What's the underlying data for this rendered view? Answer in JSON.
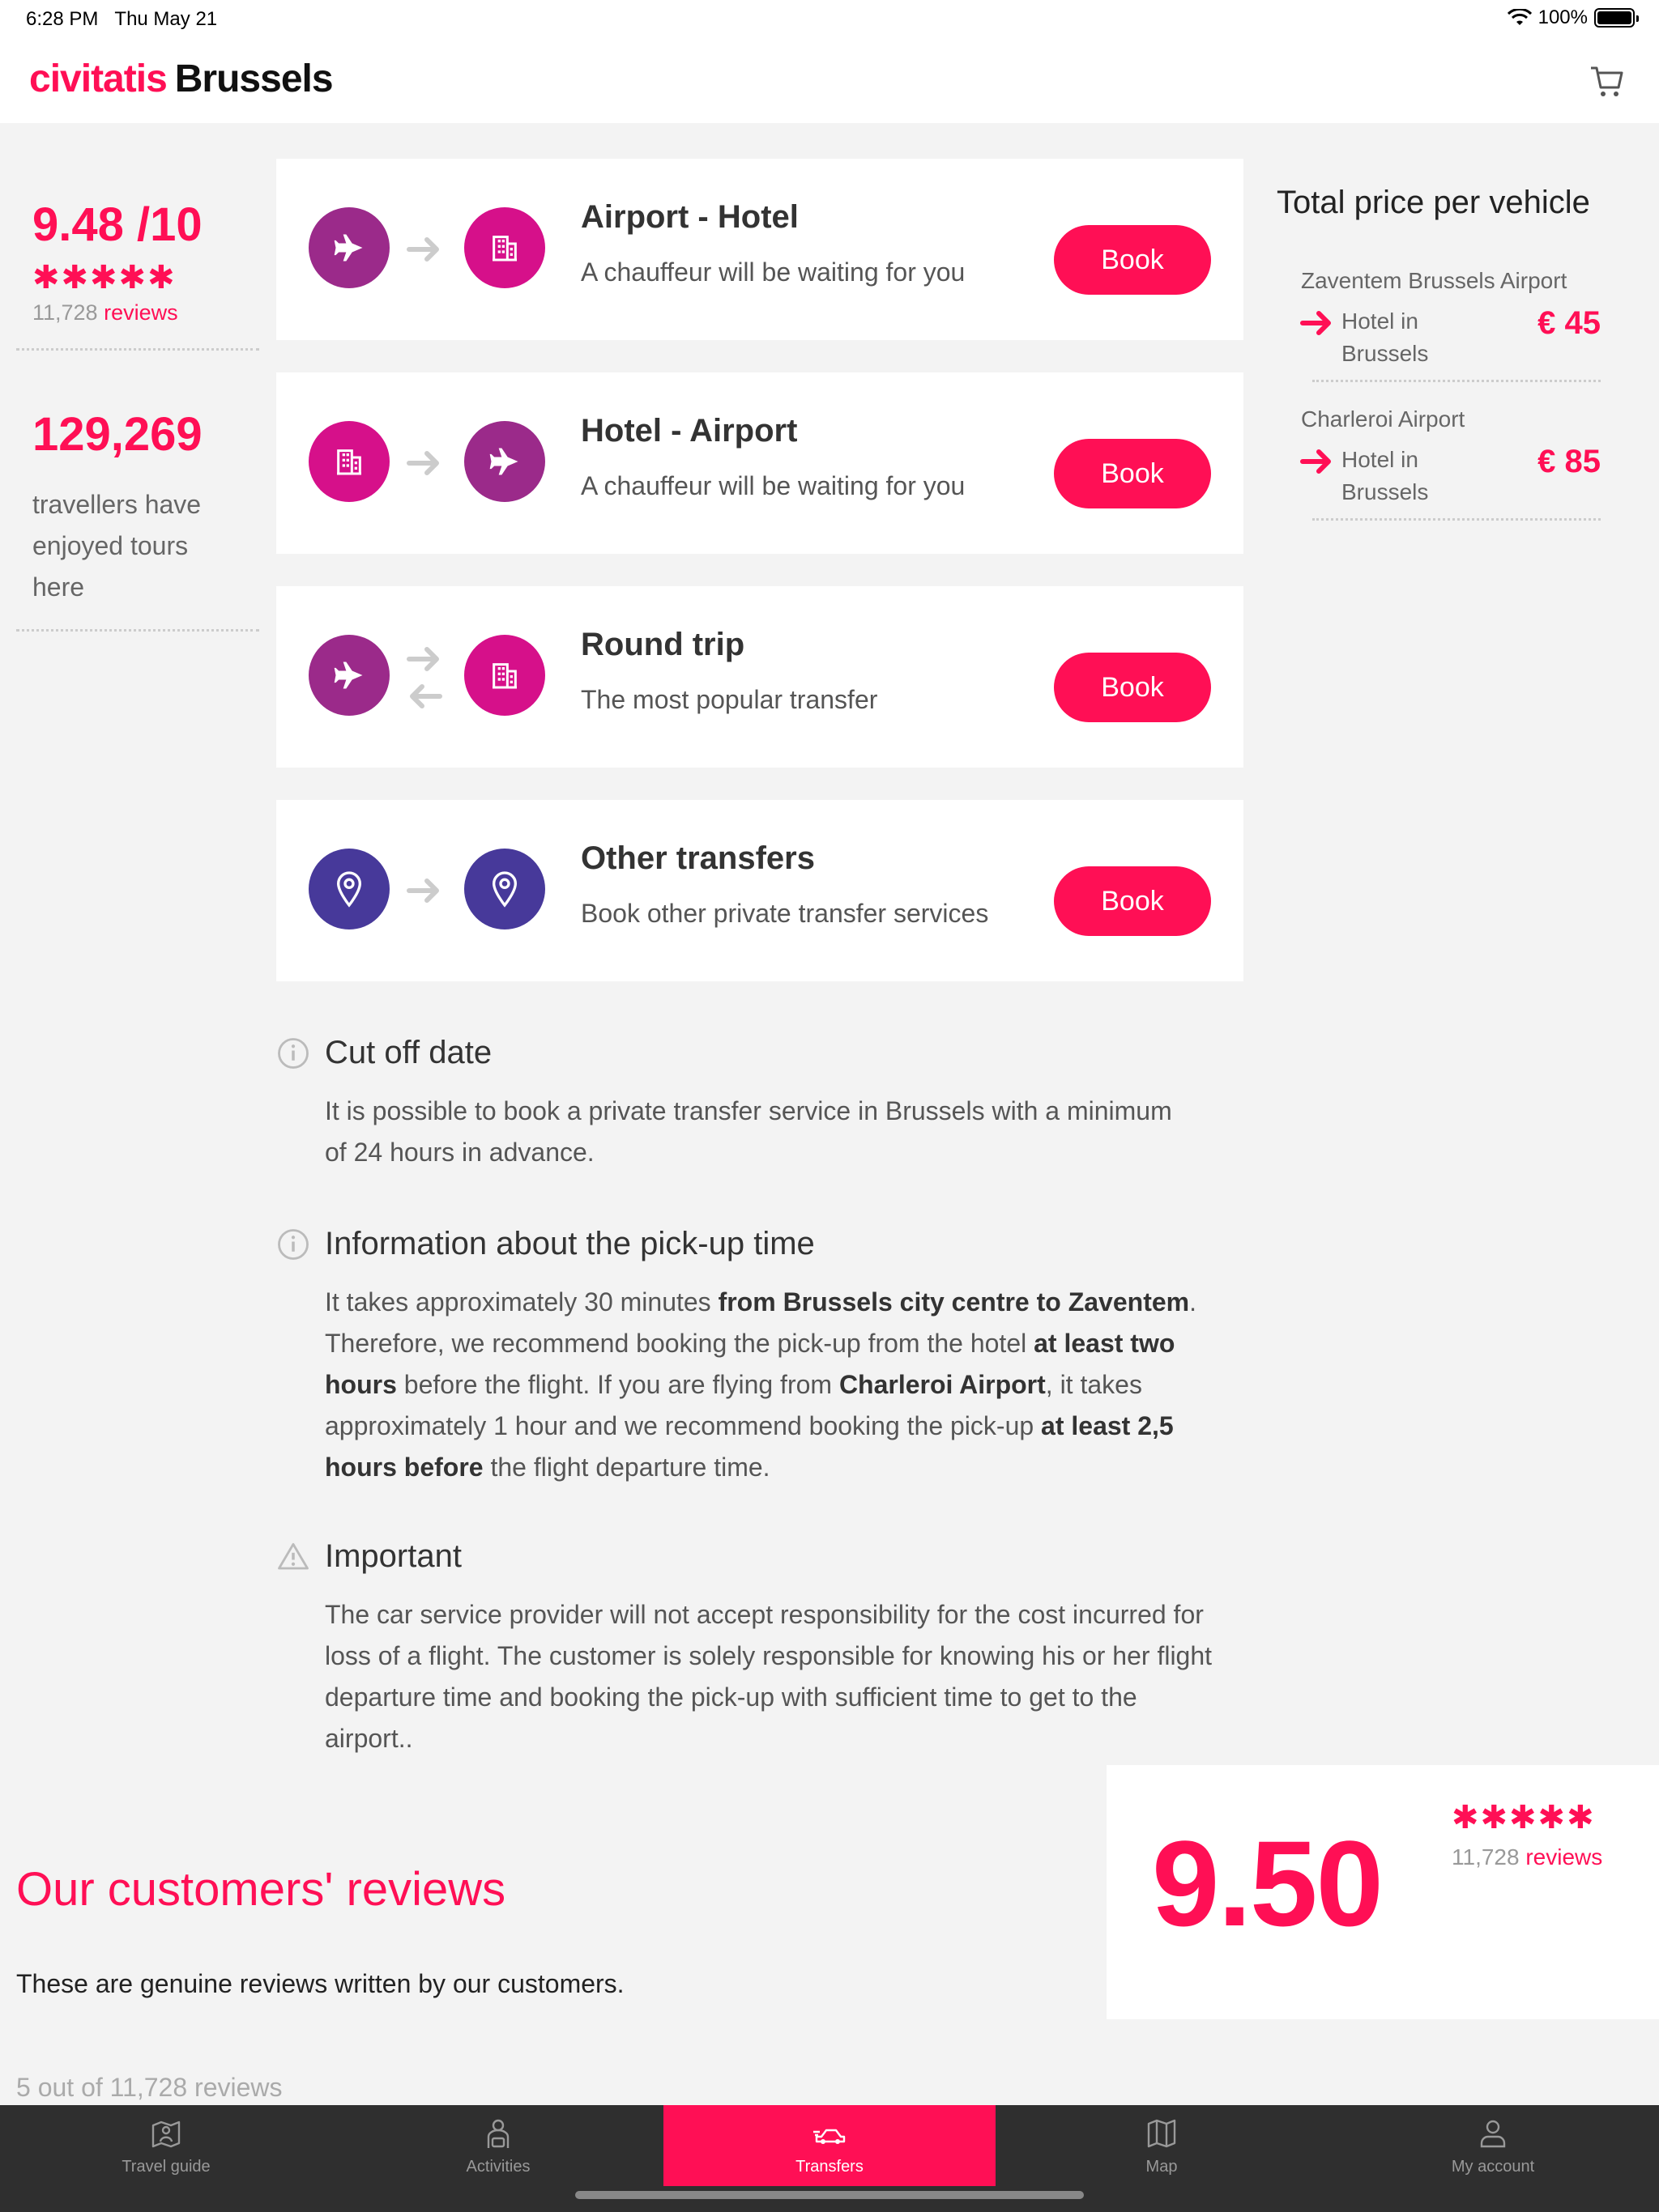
{
  "status": {
    "time": "6:28 PM",
    "date": "Thu May 21",
    "battery": "100%"
  },
  "header": {
    "logo": "civitatis",
    "city": "Brussels",
    "cart_icon": "cart-icon"
  },
  "stats": {
    "rating": "9.48 /10",
    "stars": "✱✱✱✱✱",
    "reviews_count": "11,728",
    "reviews_label": "reviews",
    "travellers": "129,269",
    "travellers_text": "travellers have enjoyed tours here"
  },
  "transfers": [
    {
      "title": "Airport - Hotel",
      "subtitle": "A chauffeur will be waiting for you",
      "button": "Book",
      "from_icon": "plane-icon",
      "to_icon": "hotel-icon"
    },
    {
      "title": "Hotel - Airport",
      "subtitle": "A chauffeur will be waiting for you",
      "button": "Book",
      "from_icon": "hotel-icon",
      "to_icon": "plane-icon"
    },
    {
      "title": "Round trip",
      "subtitle": "The most popular transfer",
      "button": "Book",
      "from_icon": "plane-icon",
      "to_icon": "hotel-icon"
    },
    {
      "title": "Other transfers",
      "subtitle": "Book other private transfer services",
      "button": "Book",
      "from_icon": "location-pin-icon",
      "to_icon": "location-pin-icon"
    }
  ],
  "pricing": {
    "title": "Total price per vehicle",
    "routes": [
      {
        "origin": "Zaventem Brussels Airport",
        "destination": "Hotel in Brussels",
        "price": "€ 45"
      },
      {
        "origin": "Charleroi Airport",
        "destination": "Hotel in Brussels",
        "price": "€ 85"
      }
    ]
  },
  "info": {
    "cutoff": {
      "title": "Cut off date",
      "text": "It is possible to book a private transfer service in Brussels with a minimum of 24 hours in advance."
    },
    "pickup": {
      "title": "Information about the pick-up time",
      "t1": "It takes approximately 30 minutes ",
      "b1": "from Brussels city centre to Zaventem",
      "t2": ". Therefore, we recommend booking the pick-up from the hotel ",
      "b2": "at least two hours",
      "t3": " before the flight. If you are flying from ",
      "b3": "Charleroi Airport",
      "t4": ", it takes approximately 1 hour and we recommend booking the pick-up ",
      "b4": "at least 2,5 hours before",
      "t5": " the flight departure time."
    },
    "important": {
      "title": "Important",
      "text": "The car service provider will not accept responsibility for the cost incurred for loss of a flight. The customer is solely responsible for knowing his or her flight departure time and booking the pick-up with sufficient time to get to the airport.."
    }
  },
  "reviews": {
    "title": "Our customers' reviews",
    "subtitle": "These are genuine reviews written by our customers.",
    "count_text": "5 out of 11,728 reviews",
    "score": "9.50",
    "stars": "✱✱✱✱✱",
    "reviews_count": "11,728",
    "reviews_label": "reviews"
  },
  "tabs": [
    {
      "label": "Travel guide",
      "icon": "map-person-icon",
      "active": false
    },
    {
      "label": "Activities",
      "icon": "guide-icon",
      "active": false
    },
    {
      "label": "Transfers",
      "icon": "car-icon",
      "active": true
    },
    {
      "label": "Map",
      "icon": "map-icon",
      "active": false
    },
    {
      "label": "My account",
      "icon": "user-icon",
      "active": false
    }
  ],
  "colors": {
    "brand": "#ff0f55",
    "purple": "#9b2a8a",
    "magenta": "#d6108a",
    "indigo": "#47399a"
  }
}
